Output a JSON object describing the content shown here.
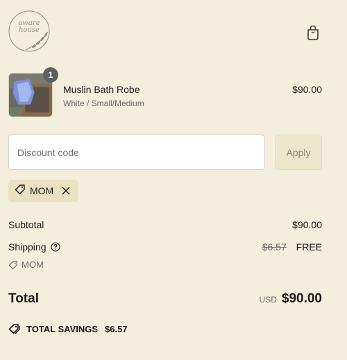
{
  "brand": {
    "logo_line1": "aware",
    "logo_line2": "house"
  },
  "cart": {
    "icon": "shopping-bag-icon"
  },
  "product": {
    "name": "Muslin Bath Robe",
    "variant": "White / Small/Medium",
    "price": "$90.00",
    "quantity": "1"
  },
  "discount": {
    "placeholder": "Discount code",
    "apply_label": "Apply",
    "applied_code": "MOM"
  },
  "summary": {
    "subtotal_label": "Subtotal",
    "subtotal_value": "$90.00",
    "shipping_label": "Shipping",
    "shipping_original": "$6.57",
    "shipping_value": "FREE",
    "shipping_code": "MOM",
    "total_label": "Total",
    "currency": "USD",
    "total_value": "$90.00",
    "savings_label": "TOTAL SAVINGS",
    "savings_value": "$6.57"
  },
  "colors": {
    "background": "#f4eedd",
    "chip": "#eae0c2",
    "apply_bg": "#ede6cc",
    "logo": "#8a8f70"
  }
}
